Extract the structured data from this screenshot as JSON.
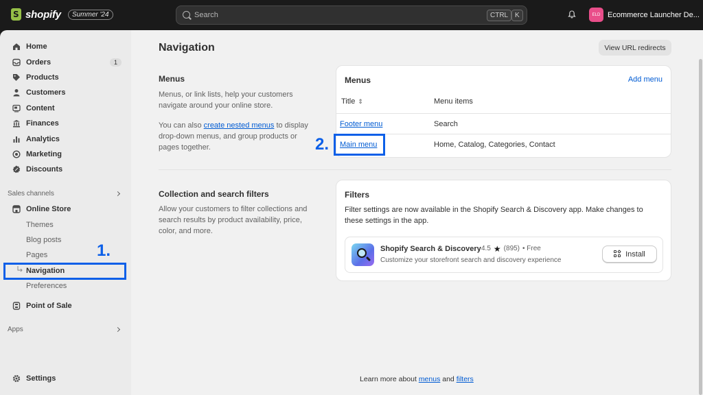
{
  "topbar": {
    "brand": "shopify",
    "edition": "Summer '24",
    "search_placeholder": "Search",
    "shortcut_ctrl": "CTRL",
    "shortcut_k": "K",
    "store_initials": "ELD",
    "store_name": "Ecommerce Launcher De..."
  },
  "sidebar": {
    "items": [
      {
        "label": "Home",
        "icon": "home-icon"
      },
      {
        "label": "Orders",
        "icon": "orders-icon",
        "badge": "1"
      },
      {
        "label": "Products",
        "icon": "tag-icon"
      },
      {
        "label": "Customers",
        "icon": "person-icon"
      },
      {
        "label": "Content",
        "icon": "content-icon"
      },
      {
        "label": "Finances",
        "icon": "bank-icon"
      },
      {
        "label": "Analytics",
        "icon": "chart-icon"
      },
      {
        "label": "Marketing",
        "icon": "target-icon"
      },
      {
        "label": "Discounts",
        "icon": "discount-icon"
      }
    ],
    "sales_channels_label": "Sales channels",
    "online_store_label": "Online Store",
    "online_store_sub": [
      "Themes",
      "Blog posts",
      "Pages",
      "Navigation",
      "Preferences"
    ],
    "point_of_sale_label": "Point of Sale",
    "apps_label": "Apps",
    "settings_label": "Settings"
  },
  "main": {
    "title": "Navigation",
    "view_redirects": "View URL redirects",
    "menus_section": {
      "title": "Menus",
      "desc1": "Menus, or link lists, help your customers navigate around your online store.",
      "desc2_pre": "You can also ",
      "desc2_link": "create nested menus",
      "desc2_post": " to display drop-down menus, and group products or pages together."
    },
    "menus_card": {
      "title": "Menus",
      "add": "Add menu",
      "col_title": "Title",
      "col_items": "Menu items",
      "rows": [
        {
          "title": "Footer menu",
          "items": "Search"
        },
        {
          "title": "Main menu",
          "items": "Home, Catalog, Categories, Contact"
        }
      ]
    },
    "filters_section": {
      "title": "Collection and search filters",
      "desc": "Allow your customers to filter collections and search results by product availability, price, color, and more."
    },
    "filters_card": {
      "title": "Filters",
      "desc": "Filter settings are now available in the Shopify Search & Discovery app. Make changes to these settings in the app.",
      "app_name": "Shopify Search & Discovery",
      "rating": "4.5",
      "reviews": "(895)",
      "price": "• Free",
      "app_sub": "Customize your storefront search and discovery experience",
      "install": "Install"
    },
    "footer": {
      "pre": "Learn more about ",
      "link1": "menus",
      "mid": " and ",
      "link2": "filters"
    }
  },
  "annotations": {
    "step1": "1.",
    "step2": "2."
  }
}
